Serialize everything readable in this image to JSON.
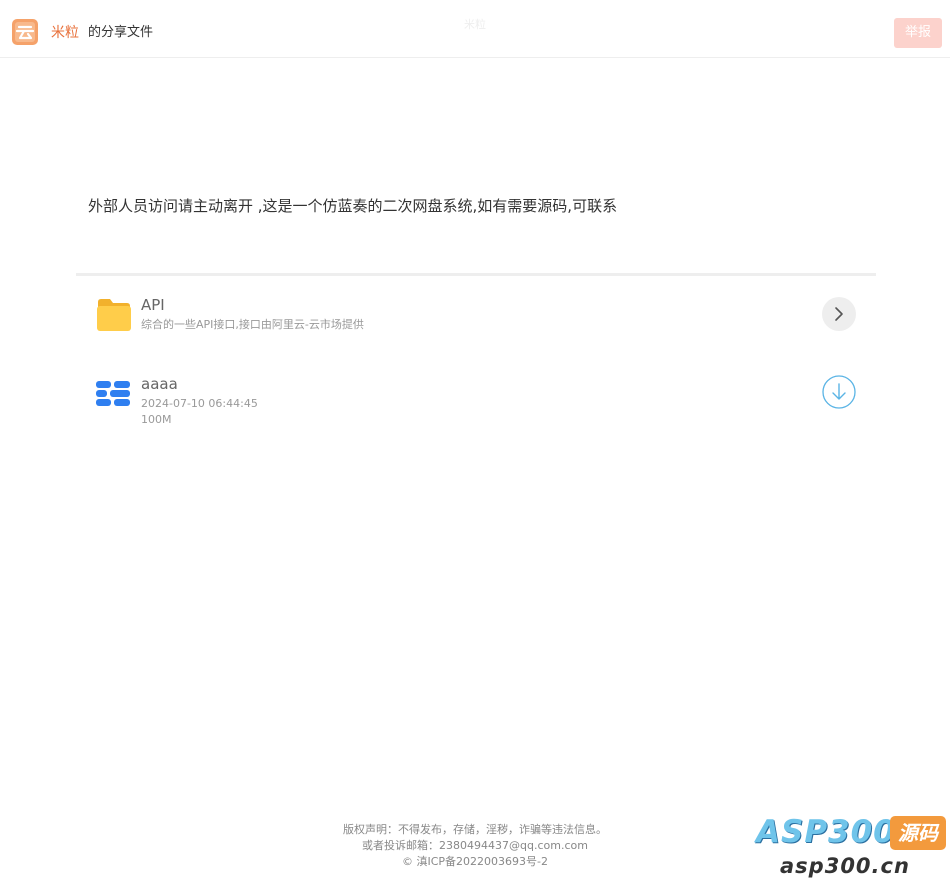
{
  "header": {
    "brand": "米粒",
    "brand_suffix": "的分享文件",
    "center_title": "米粒",
    "report_label": "举报"
  },
  "notice": "外部人员访问请主动离开 ,这是一个仿蓝奏的二次网盘系统,如有需要源码,可联系",
  "items": [
    {
      "type": "folder",
      "name": "API",
      "description": "综合的一些API接口,接口由阿里云-云市场提供",
      "icon": "folder-icon"
    },
    {
      "type": "file",
      "name": "aaaa",
      "date": "2024-07-10 06:44:45",
      "size": "100M",
      "icon": "file-icon"
    }
  ],
  "footer": {
    "line1": "版权声明：不得发布，存储，淫秽，诈骗等违法信息。",
    "line2": "或者投诉邮箱：2380494437@qq.com.com",
    "line3": "© 滇ICP备2022003693号-2"
  },
  "watermark": {
    "top": "ASP300",
    "badge": "源码",
    "bottom": "asp300.cn"
  },
  "colors": {
    "brand": "#e8703a",
    "report_button": "#fcd2cc",
    "folder": "#ffcd4a",
    "file_icon": "#2f7ff0",
    "download": "#5ab4e5"
  }
}
